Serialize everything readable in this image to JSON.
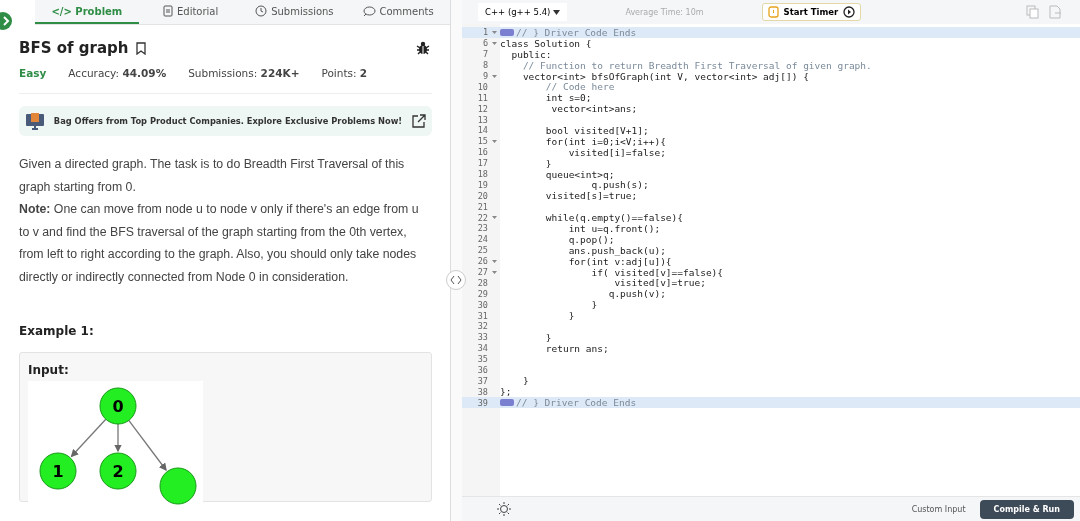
{
  "tabs": [
    {
      "label": "</> Problem",
      "selected": true
    },
    {
      "label": "Editorial",
      "selected": false
    },
    {
      "label": "Submissions",
      "selected": false
    },
    {
      "label": "Comments",
      "selected": false
    }
  ],
  "problem": {
    "title": "BFS of graph",
    "difficulty": "Easy",
    "meta": [
      "Accuracy: **44.09%**",
      "Submissions: **224K+**",
      "Points: **2**"
    ],
    "banner": "Bag Offers from Top Product Companies. Explore Exclusive Problems Now!",
    "paragraphs": [
      "Given a directed graph. The task is to do Breadth First Traversal of this graph starting from 0.",
      "**Note:** One can move from node u to node v only if there's an edge from u to v and find the BFS traversal of the graph starting from the 0th vertex, from left to right according to the graph. Also, you should only take nodes directly or indirectly connected from Node 0 in consideration."
    ],
    "example_heading": "Example 1:",
    "input_label": "Input:",
    "graph_nodes": [
      "0",
      "1",
      "2"
    ]
  },
  "editor": {
    "language": "C++ (g++ 5.4)",
    "average_time": "Average Time: 10m",
    "timer_button": "Start Timer",
    "lines": [
      {
        "number": "1",
        "fold": true,
        "highlighted": true,
        "folded": true,
        "kind": "comment",
        "text": "// } Driver Code Ends"
      },
      {
        "number": "6",
        "fold": true,
        "highlighted": false,
        "folded": false,
        "kind": "code",
        "text": "class Solution {"
      },
      {
        "number": "7",
        "fold": false,
        "highlighted": false,
        "folded": false,
        "kind": "code",
        "text": "  public:"
      },
      {
        "number": "8",
        "fold": false,
        "highlighted": false,
        "folded": false,
        "kind": "comment",
        "text": "    // Function to return Breadth First Traversal of given graph."
      },
      {
        "number": "9",
        "fold": true,
        "highlighted": false,
        "folded": false,
        "kind": "code",
        "text": "    vector<int> bfsOfGraph(int V, vector<int> adj[]) {"
      },
      {
        "number": "10",
        "fold": false,
        "highlighted": false,
        "folded": false,
        "kind": "comment",
        "text": "        // Code here"
      },
      {
        "number": "11",
        "fold": false,
        "highlighted": false,
        "folded": false,
        "kind": "code",
        "text": "        int s=0;"
      },
      {
        "number": "12",
        "fold": false,
        "highlighted": false,
        "folded": false,
        "kind": "code",
        "text": "         vector<int>ans;"
      },
      {
        "number": "13",
        "fold": false,
        "highlighted": false,
        "folded": false
      },
      {
        "number": "14",
        "fold": false,
        "highlighted": false,
        "folded": false,
        "kind": "code",
        "text": "        bool visited[V+1];"
      },
      {
        "number": "15",
        "fold": true,
        "highlighted": false,
        "folded": false,
        "kind": "code",
        "text": "        for(int i=0;i<V;i++){"
      },
      {
        "number": "16",
        "fold": false,
        "highlighted": false,
        "folded": false,
        "kind": "code",
        "text": "            visited[i]=false;"
      },
      {
        "number": "17",
        "fold": false,
        "highlighted": false,
        "folded": false,
        "kind": "code",
        "text": "        }"
      },
      {
        "number": "18",
        "fold": false,
        "highlighted": false,
        "folded": false,
        "kind": "code",
        "text": "        queue<int>q;"
      },
      {
        "number": "19",
        "fold": false,
        "highlighted": false,
        "folded": false,
        "kind": "code",
        "text": "                q.push(s);"
      },
      {
        "number": "20",
        "fold": false,
        "highlighted": false,
        "folded": false,
        "kind": "code",
        "text": "        visited[s]=true;"
      },
      {
        "number": "21",
        "fold": false,
        "highlighted": false,
        "folded": false
      },
      {
        "number": "22",
        "fold": true,
        "highlighted": false,
        "folded": false,
        "kind": "code",
        "text": "        while(q.empty()==false){"
      },
      {
        "number": "23",
        "fold": false,
        "highlighted": false,
        "folded": false,
        "kind": "code",
        "text": "            int u=q.front();"
      },
      {
        "number": "24",
        "fold": false,
        "highlighted": false,
        "folded": false,
        "kind": "code",
        "text": "            q.pop();"
      },
      {
        "number": "25",
        "fold": false,
        "highlighted": false,
        "folded": false,
        "kind": "code",
        "text": "            ans.push_back(u);"
      },
      {
        "number": "26",
        "fold": true,
        "highlighted": false,
        "folded": false,
        "kind": "code",
        "text": "            for(int v:adj[u]){"
      },
      {
        "number": "27",
        "fold": true,
        "highlighted": false,
        "folded": false,
        "kind": "code",
        "text": "                if( visited[v]==false){"
      },
      {
        "number": "28",
        "fold": false,
        "highlighted": false,
        "folded": false,
        "kind": "code",
        "text": "                    visited[v]=true;"
      },
      {
        "number": "29",
        "fold": false,
        "highlighted": false,
        "folded": false,
        "kind": "code",
        "text": "                   q.push(v);"
      },
      {
        "number": "30",
        "fold": false,
        "highlighted": false,
        "folded": false,
        "kind": "code",
        "text": "                }"
      },
      {
        "number": "31",
        "fold": false,
        "highlighted": false,
        "folded": false,
        "kind": "code",
        "text": "            }"
      },
      {
        "number": "32",
        "fold": false,
        "highlighted": false,
        "folded": false
      },
      {
        "number": "33",
        "fold": false,
        "highlighted": false,
        "folded": false,
        "kind": "code",
        "text": "        }"
      },
      {
        "number": "34",
        "fold": false,
        "highlighted": false,
        "folded": false,
        "kind": "code",
        "text": "        return ans;"
      },
      {
        "number": "35",
        "fold": false,
        "highlighted": false,
        "folded": false
      },
      {
        "number": "36",
        "fold": false,
        "highlighted": false,
        "folded": false
      },
      {
        "number": "37",
        "fold": false,
        "highlighted": false,
        "folded": false,
        "kind": "code",
        "text": "    }"
      },
      {
        "number": "38",
        "fold": false,
        "highlighted": false,
        "folded": false,
        "kind": "code",
        "text": "};"
      },
      {
        "number": "39",
        "fold": false,
        "highlighted": true,
        "folded": true,
        "kind": "comment",
        "text": "// } Driver Code Ends"
      }
    ],
    "custom_input": "Custom Input",
    "run_button": "Compile & Run"
  }
}
